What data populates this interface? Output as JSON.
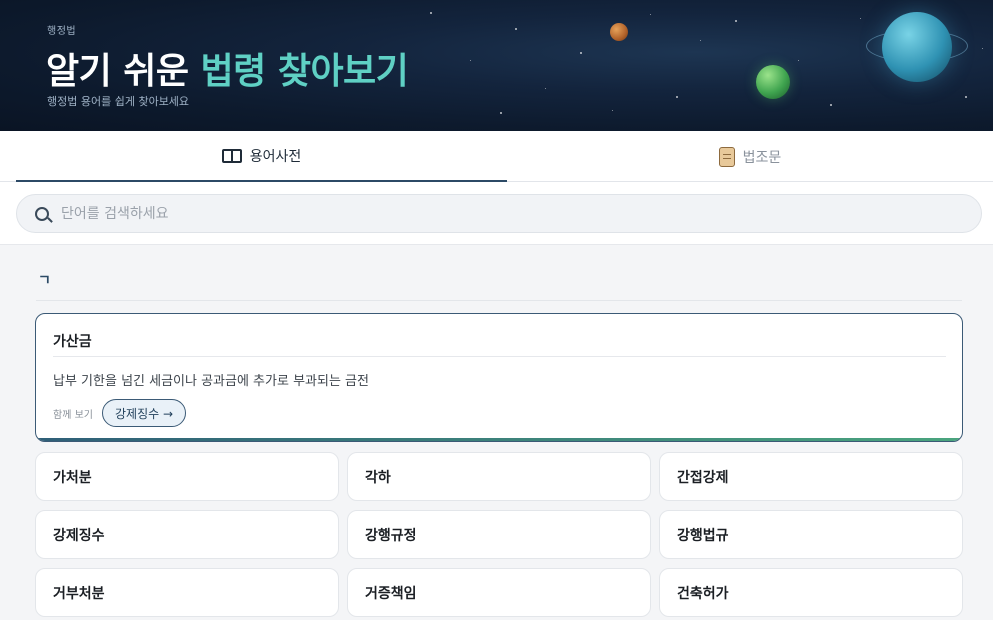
{
  "hero": {
    "kicker": "행정법",
    "title_plain": "알기 쉬운 ",
    "title_accent": "법령 찾아보기",
    "subtitle": "행정법 용어를 쉽게 찾아보세요"
  },
  "tabs": [
    {
      "label": "용어사전",
      "icon": "book-icon",
      "active": true
    },
    {
      "label": "법조문",
      "icon": "scroll-icon",
      "active": false
    }
  ],
  "search": {
    "placeholder": "단어를 검색하세요",
    "value": ""
  },
  "section": {
    "letter": "ㄱ"
  },
  "featured": {
    "term": "가산금",
    "definition": "납부 기한을 넘긴 세금이나 공과금에 추가로 부과되는 금전",
    "see_also_label": "함께 보기",
    "see_also_link": "강제징수 →"
  },
  "terms": [
    "가처분",
    "각하",
    "간접강제",
    "강제징수",
    "강행규정",
    "강행법규",
    "거부처분",
    "거증책임",
    "건축허가"
  ],
  "colors": {
    "hero_bg": "#0d1a2d",
    "accent_teal": "#5fd0c4",
    "primary_navy": "#2c4a66"
  }
}
